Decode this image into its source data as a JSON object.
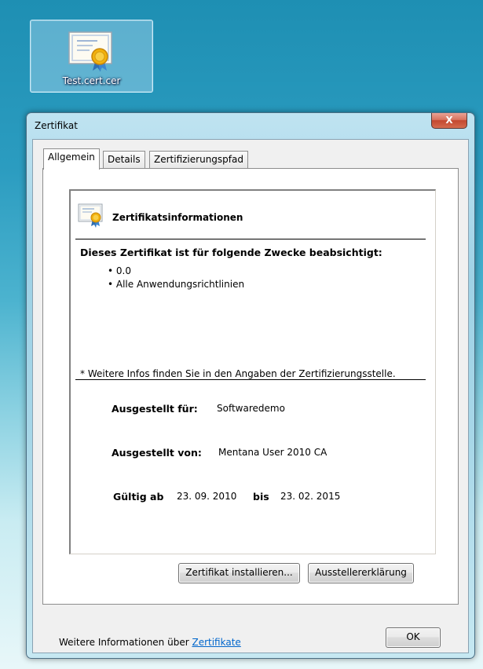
{
  "desktop": {
    "icon_label": "Test.cert.cer",
    "icon": "certificate-icon"
  },
  "window": {
    "title": "Zertifikat",
    "close_label": "X"
  },
  "tabs": [
    {
      "label": "Allgemein",
      "active": true
    },
    {
      "label": "Details",
      "active": false
    },
    {
      "label": "Zertifizierungspfad",
      "active": false
    }
  ],
  "info": {
    "heading": "Zertifikatsinformationen",
    "purpose_title": "Dieses Zertifikat ist für folgende Zwecke beabsichtigt:",
    "purposes": [
      "• 0.0",
      "• Alle Anwendungsrichtlinien"
    ],
    "note": "* Weitere Infos finden Sie in den Angaben der Zertifizierungsstelle.",
    "issued_to_label": "Ausgestellt für:",
    "issued_to_value": "Softwaredemo",
    "issued_by_label": "Ausgestellt von:",
    "issued_by_value": "Mentana User 2010 CA",
    "valid_from_label": "Gültig ab",
    "valid_from_value": "23. 09. 2010",
    "valid_to_label": "bis",
    "valid_to_value": "23. 02. 2015"
  },
  "buttons": {
    "install": "Zertifikat installieren...",
    "issuer_statement": "Ausstellererklärung",
    "ok": "OK"
  },
  "footer": {
    "more_info_text": "Weitere Informationen über",
    "more_info_link": "Zertifikate"
  },
  "colors": {
    "link": "#0066cc",
    "desktop_top": "#1e8fb3",
    "close_button": "#c3482f"
  }
}
